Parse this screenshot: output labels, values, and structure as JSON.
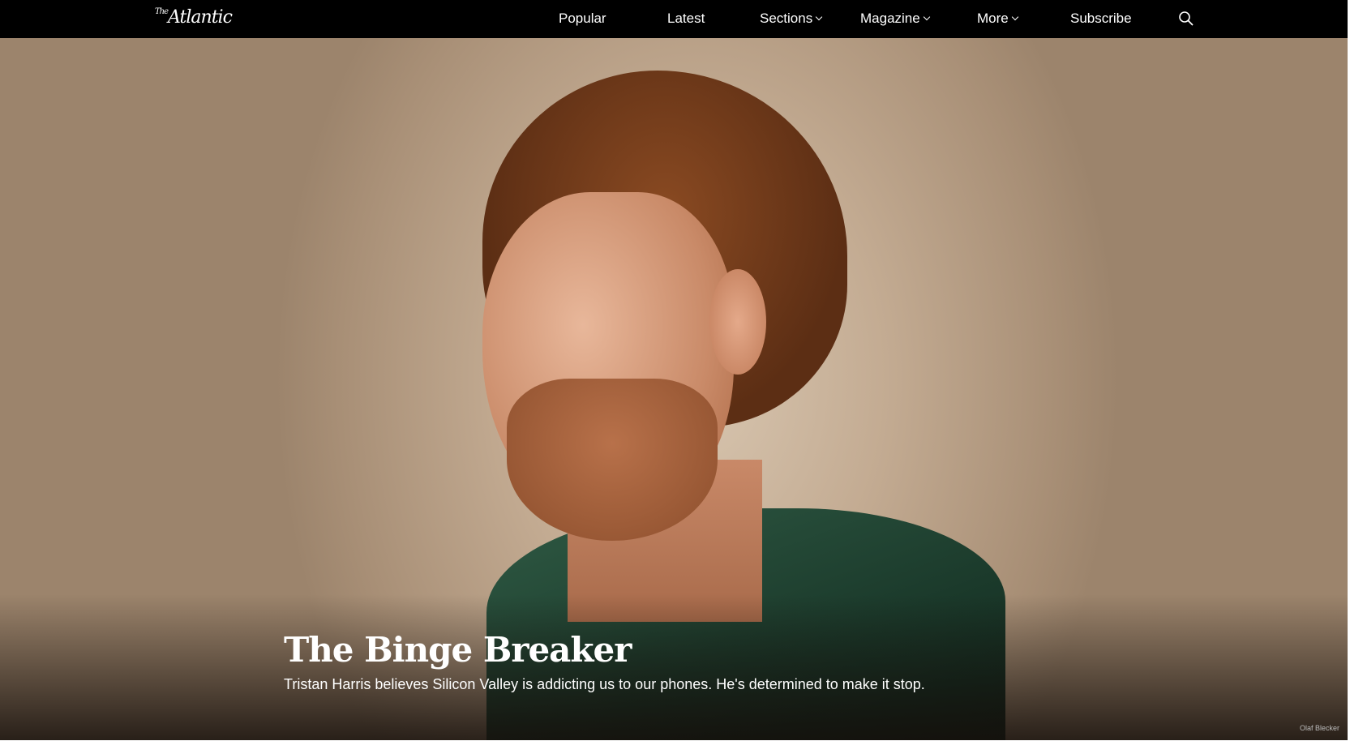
{
  "nav": {
    "logo": {
      "prefix": "The",
      "name": "Atlantic"
    },
    "items": [
      {
        "label": "Popular"
      },
      {
        "label": "Latest"
      },
      {
        "label": "Sections",
        "dropdown": true
      },
      {
        "label": "Magazine",
        "dropdown": true
      },
      {
        "label": "More",
        "dropdown": true
      },
      {
        "label": "Subscribe"
      }
    ],
    "search_icon": "search-icon"
  },
  "hero": {
    "title": "The Binge Breaker",
    "subtitle": "Tristan Harris believes Silicon Valley is addicting us to our phones. He's determined to make it stop.",
    "photo_credit": "Olaf Blecker"
  }
}
